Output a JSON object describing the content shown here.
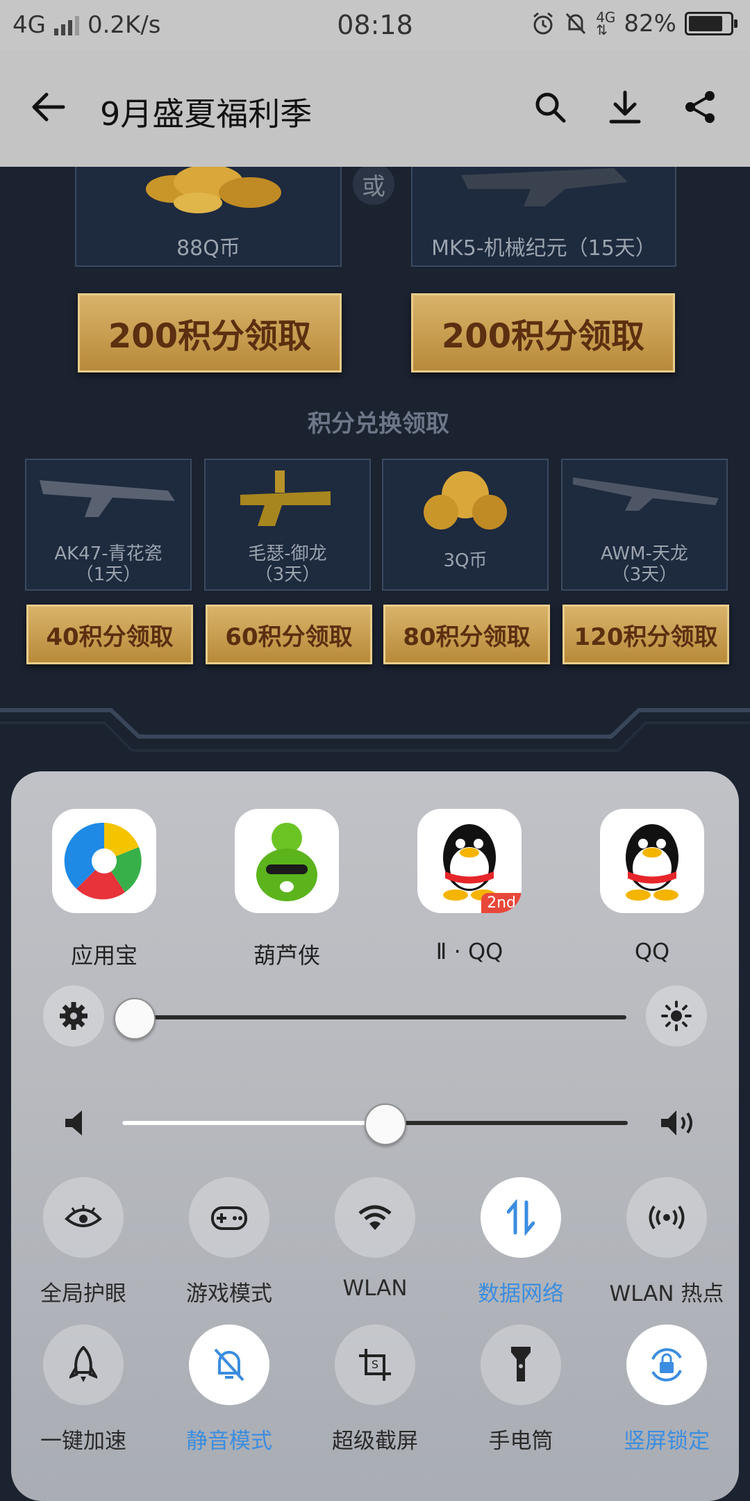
{
  "status_bar": {
    "network": "4G",
    "speed": "0.2K/s",
    "time": "08:18",
    "battery": "82%",
    "battery_level": 0.82
  },
  "app_bar": {
    "title": "9月盛夏福利季"
  },
  "content": {
    "or_label": "或",
    "top_rewards": [
      {
        "name": "88Q币",
        "button": "200积分领取"
      },
      {
        "name": "MK5-机械纪元（15天）",
        "button": "200积分领取"
      }
    ],
    "section_title": "积分兑换领取",
    "rewards": [
      {
        "name": "AK47-青花瓷",
        "duration": "（1天）",
        "button": "40积分领取"
      },
      {
        "name": "毛瑟-御龙",
        "duration": "（3天）",
        "button": "60积分领取"
      },
      {
        "name": "3Q币",
        "duration": "",
        "button": "80积分领取"
      },
      {
        "name": "AWM-天龙",
        "duration": "（3天）",
        "button": "120积分领取"
      }
    ]
  },
  "panel": {
    "apps": [
      {
        "label": "应用宝",
        "icon": "yingyongbao-icon"
      },
      {
        "label": "葫芦侠",
        "icon": "huluxia-icon"
      },
      {
        "label": "Ⅱ · QQ",
        "icon": "qq-clone-icon",
        "badge": "2nd"
      },
      {
        "label": "QQ",
        "icon": "qq-icon"
      }
    ],
    "brightness_level": 0.0,
    "volume_level": 0.52,
    "toggles_row1": [
      {
        "label": "全局护眼",
        "icon": "eye-icon",
        "on": false
      },
      {
        "label": "游戏模式",
        "icon": "gamepad-icon",
        "on": false
      },
      {
        "label": "WLAN",
        "icon": "wifi-icon",
        "on": false
      },
      {
        "label": "数据网络",
        "icon": "data-network-icon",
        "on": true
      },
      {
        "label": "WLAN 热点",
        "icon": "hotspot-icon",
        "on": false
      }
    ],
    "toggles_row2": [
      {
        "label": "一键加速",
        "icon": "rocket-icon",
        "on": false
      },
      {
        "label": "静音模式",
        "icon": "mute-bell-icon",
        "on": true
      },
      {
        "label": "超级截屏",
        "icon": "screenshot-icon",
        "on": false
      },
      {
        "label": "手电筒",
        "icon": "flashlight-icon",
        "on": false
      },
      {
        "label": "竖屏锁定",
        "icon": "rotation-lock-icon",
        "on": true
      }
    ],
    "accent_color": "#3b8de0"
  }
}
